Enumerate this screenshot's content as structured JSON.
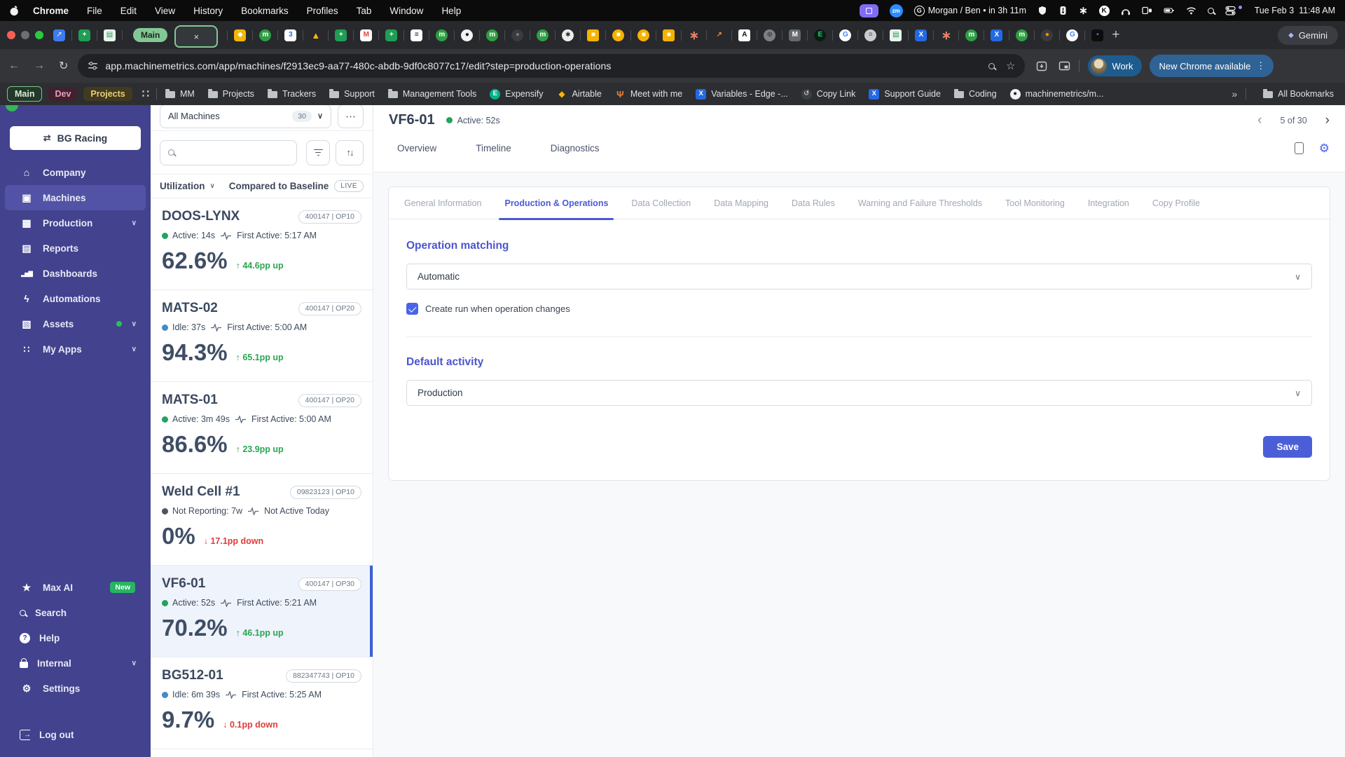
{
  "menubar": {
    "items": [
      {
        "label": "Chrome",
        "cls": "b"
      },
      {
        "label": "File",
        "cls": ""
      },
      {
        "label": "Edit",
        "cls": ""
      },
      {
        "label": "View",
        "cls": ""
      },
      {
        "label": "History",
        "cls": ""
      },
      {
        "label": "Bookmarks",
        "cls": ""
      },
      {
        "label": "Profiles",
        "cls": ""
      },
      {
        "label": "Tab",
        "cls": ""
      },
      {
        "label": "Window",
        "cls": ""
      },
      {
        "label": "Help",
        "cls": ""
      }
    ],
    "zoom_label": "zm",
    "k_label": "K",
    "g_label": "G",
    "user": "Morgan / Ben • in 3h 11m",
    "clock": "Tue Feb 3  11:48 AM"
  },
  "tabstrip": {
    "group_label": "Main",
    "close_glyph": "×",
    "newtab_glyph": "+",
    "gemini_label": "Gemini",
    "gemini_icon": "◆",
    "pinned": [
      {
        "g": "↗",
        "s": "background:#3d7bf0;color:#fff;border-radius:4px"
      },
      {
        "g": "+",
        "s": "background:#1f9d55;color:#fff;border-radius:4px;font-weight:700"
      },
      {
        "g": "▤",
        "s": "background:#eaf4ec;color:#1f9d55;border-radius:3px"
      }
    ],
    "tabs": [
      {
        "g": "◆",
        "s": "background:#f2b705;color:#fff;border-radius:4px"
      },
      {
        "g": "m",
        "s": "background:#2f9e44;color:#fff;border-radius:50%;font-weight:700"
      },
      {
        "g": "3",
        "s": "background:#fff;color:#1a73e8;border-radius:4px;font-weight:700"
      },
      {
        "g": "▲",
        "s": "color:#fbbc05;font-size:13px"
      },
      {
        "g": "+",
        "s": "background:#1f9d55;color:#fff;border-radius:4px;font-weight:700"
      },
      {
        "g": "M",
        "s": "background:#fff;color:#ea4335;border-radius:4px;font-weight:700"
      },
      {
        "g": "+",
        "s": "background:#1f9d55;color:#fff;border-radius:4px;font-weight:700"
      },
      {
        "g": "≡",
        "s": "background:#fff;color:#15171a;border-radius:4px;font-weight:700"
      },
      {
        "g": "m",
        "s": "background:#2f9e44;color:#fff;border-radius:50%;font-weight:700"
      },
      {
        "g": "●",
        "s": "background:#f2f2f3;color:#1b1f23;border-radius:50%"
      },
      {
        "g": "m",
        "s": "background:#2f9e44;color:#fff;border-radius:50%;font-weight:700"
      },
      {
        "g": "●",
        "s": "background:#393b3f;color:#74777c;border-radius:50%"
      },
      {
        "g": "m",
        "s": "background:#2f9e44;color:#fff;border-radius:50%;font-weight:700"
      },
      {
        "g": "∗",
        "s": "background:#ededee;color:#161616;border-radius:50%;font-weight:700"
      },
      {
        "g": "■",
        "s": "background:#f5b301;color:#fff;border-radius:3px"
      },
      {
        "g": "■",
        "s": "background:#f5b301;color:#fff;border-radius:50%"
      },
      {
        "g": "■",
        "s": "background:#f5b301;color:#fff;border-radius:50%"
      },
      {
        "g": "■",
        "s": "background:#f5b301;color:#fff;border-radius:3px"
      },
      {
        "g": "∗",
        "s": "color:#e8836b;font-size:17px;font-weight:700"
      },
      {
        "g": "↗",
        "s": "color:#ef8a3d;font-weight:700"
      },
      {
        "g": "A",
        "s": "background:#fff;color:#141413;border-radius:3px;font-weight:700"
      },
      {
        "g": "⊕",
        "s": "background:#7c8085;color:#2f3134;border-radius:50%"
      },
      {
        "g": "M",
        "s": "background:#66696e;color:#fff;border-radius:4px;font-weight:700"
      },
      {
        "g": "E",
        "s": "background:#071f12;color:#2ecc71;border-radius:50%;font-weight:700"
      },
      {
        "g": "G",
        "s": "background:#fff;color:#4285f4;border-radius:50%;font-weight:700"
      },
      {
        "g": "≡",
        "s": "background:#c9cbce;color:#5a5d62;border-radius:50%"
      },
      {
        "g": "▤",
        "s": "background:#eaf4ec;color:#1f9d55;border-radius:3px"
      },
      {
        "g": "X",
        "s": "background:#2469e4;color:#fff;border-radius:4px;font-weight:700"
      },
      {
        "g": "∗",
        "s": "color:#e8836b;font-size:17px;font-weight:700"
      },
      {
        "g": "m",
        "s": "background:#2f9e44;color:#fff;border-radius:50%;font-weight:700"
      },
      {
        "g": "X",
        "s": "background:#2469e4;color:#fff;border-radius:4px;font-weight:700"
      },
      {
        "g": "m",
        "s": "background:#2f9e44;color:#fff;border-radius:50%;font-weight:700"
      },
      {
        "g": "●",
        "s": "background:#3a3b3f;color:#ff9500;border-radius:50%"
      },
      {
        "g": "G",
        "s": "background:#fff;color:#4285f4;border-radius:50%;font-weight:700"
      },
      {
        "g": "▪",
        "s": "background:#0c0c0d;color:#3b82f6;border-radius:4px"
      }
    ]
  },
  "toolbar": {
    "url": "app.machinemetrics.com/app/machines/f2913ec9-aa77-480c-abdb-9df0c8077c17/edit?step=production-operations",
    "profile_label": "Work",
    "update_label": "New Chrome available",
    "back": "←",
    "forward": "→",
    "reload": "↻",
    "star": "☆",
    "kebab": "⋮"
  },
  "bookmarks": {
    "pills": [
      {
        "label": "Main",
        "cls": "main"
      },
      {
        "label": "Dev",
        "cls": "dev"
      },
      {
        "label": "Projects",
        "cls": "proj"
      }
    ],
    "grid_icon": "∷",
    "items": [
      {
        "label": "MM",
        "icls": "bico folder"
      },
      {
        "label": "Projects",
        "icls": "bico folder"
      },
      {
        "label": "Trackers",
        "icls": "bico folder"
      },
      {
        "label": "Support",
        "icls": "bico folder"
      },
      {
        "label": "Management Tools",
        "icls": "bico folder"
      },
      {
        "label": "Expensify",
        "g": "E",
        "istyle": "background:#03b388;color:#fff;border-radius:50%;font-weight:700"
      },
      {
        "label": "Airtable",
        "g": "◆",
        "istyle": "color:#fcb400;font-size:12px"
      },
      {
        "label": "Meet with me",
        "g": "Ψ",
        "istyle": "color:#e8833a;font-size:13px;font-weight:700"
      },
      {
        "label": "Variables - Edge -...",
        "g": "X",
        "istyle": "background:#2469e4;color:#fff;border-radius:3px;font-weight:700"
      },
      {
        "label": "Copy Link",
        "g": "↺",
        "istyle": "background:#3c4043;color:#e9eaec;border-radius:50%"
      },
      {
        "label": "Support Guide",
        "g": "X",
        "istyle": "background:#2469e4;color:#fff;border-radius:3px;font-weight:700"
      },
      {
        "label": "Coding",
        "icls": "bico folder"
      },
      {
        "label": "machinemetrics/m...",
        "g": "●",
        "istyle": "background:#f2f2f3;color:#1b1f23;border-radius:50%"
      }
    ],
    "overflow": "»",
    "all_label": "All Bookmarks"
  },
  "sidebar": {
    "org": "BG Racing",
    "org_icon": "⇄",
    "items": [
      {
        "label": "Company",
        "icon": "⌂",
        "cls": "nav",
        "chev": ""
      },
      {
        "label": "Machines",
        "icon": "▣",
        "cls": "nav active",
        "chev": ""
      },
      {
        "label": "Production",
        "icon": "▦",
        "cls": "nav",
        "chev": "∨"
      },
      {
        "label": "Reports",
        "icon": "▤",
        "cls": "nav",
        "chev": ""
      },
      {
        "label": "Dashboards",
        "icon": "▂▅▇",
        "cls": "nav",
        "icls": "ni bars",
        "chev": ""
      },
      {
        "label": "Automations",
        "icon": "ϟ",
        "cls": "nav",
        "chev": ""
      },
      {
        "label": "Assets",
        "icon": "▧",
        "cls": "nav",
        "chev": "∨",
        "dot": "display:inline-block"
      },
      {
        "label": "My Apps",
        "icon": "∷",
        "cls": "nav",
        "chev": "∨"
      }
    ],
    "footer": [
      {
        "label": "Max AI",
        "icon": "★",
        "cls": "nav",
        "chev": "",
        "badge": "New",
        "badge_style": "display:inline-block"
      },
      {
        "label": "Search",
        "icon": "",
        "icls": "ni mag",
        "cls": "nav",
        "chev": ""
      },
      {
        "label": "Help",
        "icon": "?",
        "icls": "ni qcirc",
        "cls": "nav",
        "chev": ""
      },
      {
        "label": "Internal",
        "icon": "",
        "icls": "ni lockb",
        "cls": "nav",
        "chev": "∨"
      },
      {
        "label": "Settings",
        "icon": "⚙",
        "cls": "nav",
        "chev": ""
      }
    ],
    "logout": [
      {
        "label": "Log out",
        "icon": "→",
        "icls": "ni outico",
        "cls": "nav",
        "chev": ""
      }
    ]
  },
  "panel": {
    "filter_label": "All Machines",
    "count": "30",
    "chevron": "∨",
    "more": "⋯",
    "sort_icon": "↑↓",
    "sort_label": "Utilization",
    "baseline_label": "Compared to Baseline",
    "live_label": "LIVE",
    "machines": [
      {
        "name": "DOOS-LYNX",
        "tag": "400147 | OP10",
        "dot": "background:#21a45d",
        "status": "Active: 14s",
        "first": "First Active: 5:17 AM",
        "pct": "62.6%",
        "arrow": "↑",
        "delta": "44.6pp up",
        "dcls": "up",
        "ccls": "mcard"
      },
      {
        "name": "MATS-02",
        "tag": "400147 | OP20",
        "dot": "background:#3f8cca",
        "status": "Idle: 37s",
        "first": "First Active: 5:00 AM",
        "pct": "94.3%",
        "arrow": "↑",
        "delta": "65.1pp up",
        "dcls": "up",
        "ccls": "mcard"
      },
      {
        "name": "MATS-01",
        "tag": "400147 | OP20",
        "dot": "background:#21a45d",
        "status": "Active: 3m 49s",
        "first": "First Active: 5:00 AM",
        "pct": "86.6%",
        "arrow": "↑",
        "delta": "23.9pp up",
        "dcls": "up",
        "ccls": "mcard"
      },
      {
        "name": "Weld Cell #1",
        "tag": "09823123 | OP10",
        "dot": "background:#4b5563",
        "status": "Not Reporting: 7w",
        "first": "Not Active Today",
        "pct": "0%",
        "arrow": "↓",
        "delta": "17.1pp down",
        "dcls": "down",
        "ccls": "mcard"
      },
      {
        "name": "VF6-01",
        "tag": "400147 | OP30",
        "dot": "background:#21a45d",
        "status": "Active: 52s",
        "first": "First Active: 5:21 AM",
        "pct": "70.2%",
        "arrow": "↑",
        "delta": "46.1pp up",
        "dcls": "up",
        "ccls": "mcard sel"
      },
      {
        "name": "BG512-01",
        "tag": "882347743 | OP10",
        "dot": "background:#3f8cca",
        "status": "Idle: 6m 39s",
        "first": "First Active: 5:25 AM",
        "pct": "9.7%",
        "arrow": "↓",
        "delta": "0.1pp down",
        "dcls": "down",
        "ccls": "mcard"
      }
    ]
  },
  "main": {
    "title": "VF6-01",
    "status": "Active: 52s",
    "pager_prev": "‹",
    "pager_label": "5 of 30",
    "pager_next": "›",
    "gear_icon": "⚙",
    "tabs": [
      "Overview",
      "Timeline",
      "Diagnostics"
    ],
    "settings_tabs": [
      {
        "label": "General Information",
        "cls": ""
      },
      {
        "label": "Production & Operations",
        "cls": "active"
      },
      {
        "label": "Data Collection",
        "cls": ""
      },
      {
        "label": "Data Mapping",
        "cls": ""
      },
      {
        "label": "Data Rules",
        "cls": ""
      },
      {
        "label": "Warning and Failure Thresholds",
        "cls": ""
      },
      {
        "label": "Tool Monitoring",
        "cls": ""
      },
      {
        "label": "Integration",
        "cls": ""
      },
      {
        "label": "Copy Profile",
        "cls": ""
      }
    ],
    "form": {
      "op_heading": "Operation matching",
      "op_value": "Automatic",
      "chevron": "∨",
      "run_label": "Create run when operation changes",
      "act_heading": "Default activity",
      "act_value": "Production",
      "save_label": "Save"
    },
    "accent": "#4b5bd6",
    "save_color": "#4a5fd7"
  }
}
